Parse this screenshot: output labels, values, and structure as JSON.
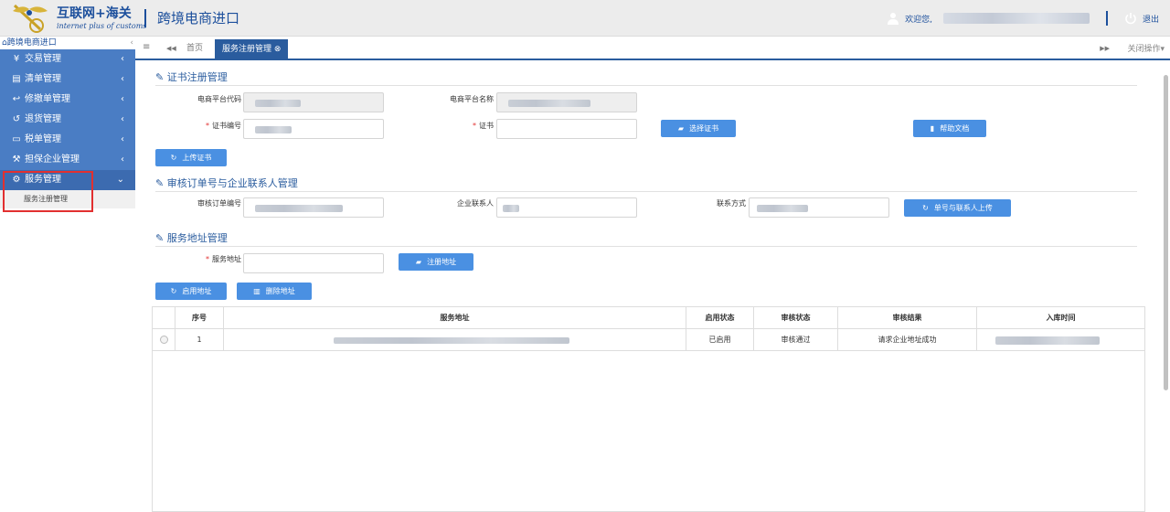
{
  "header": {
    "logo_title": "互联网+海关",
    "logo_subtitle": "internet plus of customs",
    "app_title": "跨境电商进口",
    "welcome": "欢迎您,",
    "logout": "退出"
  },
  "sidebar": {
    "root_label": "跨境电商进口",
    "collapse": "‹",
    "items": [
      {
        "label": "交易管理",
        "icon": "yen-icon",
        "glyph": "¥"
      },
      {
        "label": "清单管理",
        "icon": "document-icon",
        "glyph": "▤"
      },
      {
        "label": "修撤单管理",
        "icon": "reply-icon",
        "glyph": "↩"
      },
      {
        "label": "退货管理",
        "icon": "undo-icon",
        "glyph": "↺"
      },
      {
        "label": "税单管理",
        "icon": "card-icon",
        "glyph": "▭"
      },
      {
        "label": "担保企业管理",
        "icon": "gavel-icon",
        "glyph": "⚒"
      },
      {
        "label": "服务管理",
        "icon": "gear-icon",
        "glyph": "⚙"
      }
    ],
    "sub_item": "服务注册管理",
    "chevron_closed": "‹",
    "chevron_open": "⌄"
  },
  "tabs": {
    "menu_glyph": "≡",
    "prev_glyph": "◀◀",
    "home": "首页",
    "active": "服务注册管理",
    "active_close": "⊗",
    "next_glyph": "▶▶",
    "close_ops": "关闭操作▾"
  },
  "cert": {
    "title": "证书注册管理",
    "platform_code_label": "电商平台代码",
    "platform_name_label": "电商平台名称",
    "cert_no_label": "证书编号",
    "cert_label": "证书",
    "choose_cert": "选择证书",
    "help_doc": "帮助文档",
    "upload_cert": "上传证书",
    "required": "*"
  },
  "audit": {
    "title": "审核订单号与企业联系人管理",
    "order_no_label": "审核订单编号",
    "contact_label": "企业联系人",
    "phone_label": "联系方式",
    "upload": "单号与联系人上传"
  },
  "address": {
    "title": "服务地址管理",
    "service_address_label": "服务地址",
    "register": "注册地址",
    "enable": "启用地址",
    "delete": "删除地址"
  },
  "table": {
    "headers": [
      "序号",
      "服务地址",
      "启用状态",
      "审核状态",
      "审核结果",
      "入库时间"
    ],
    "rows": [
      {
        "index": "1",
        "enable_status": "已启用",
        "audit_status": "审核通过",
        "audit_result": "请求企业地址成功"
      }
    ]
  },
  "colors": {
    "primary": "#2a5c9e",
    "sidebar": "#4a7dc4",
    "button": "#4a90e2",
    "highlight": "#e23030"
  }
}
